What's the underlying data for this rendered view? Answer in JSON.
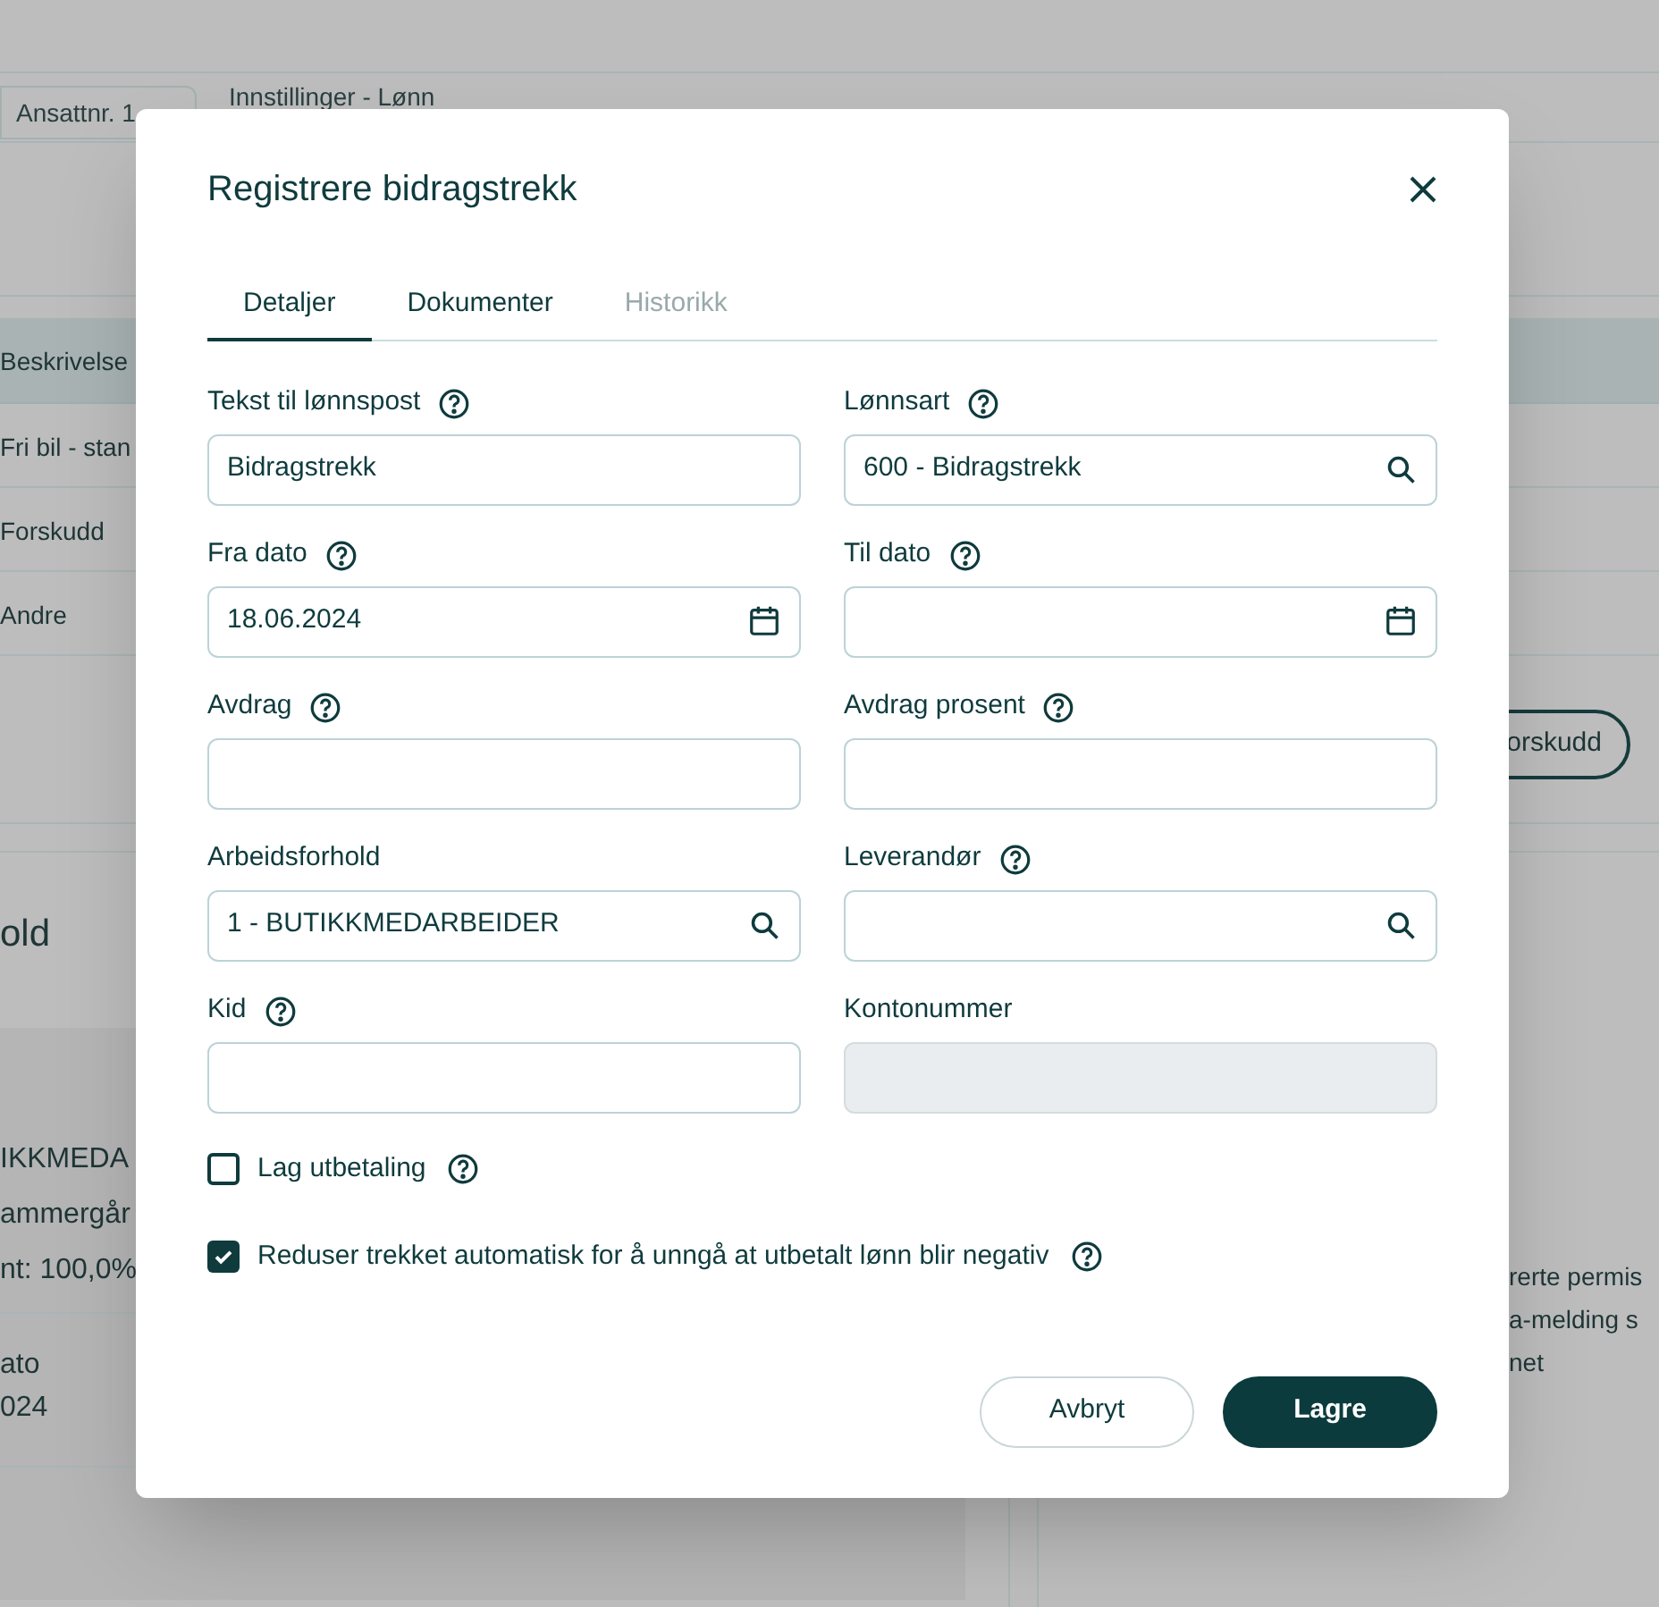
{
  "background": {
    "employee_chip": "Ansattnr. 1",
    "breadcrumb": "Innstillinger - Lønn",
    "table_header": "Beskrivelse",
    "table_rows": [
      "Fri bil - stan",
      "Forskudd",
      "Andre"
    ],
    "section_title": "old",
    "details": [
      "IKKMEDA",
      "ammergår",
      "nt: 100,0%"
    ],
    "date_label": "ato",
    "date_value": "024",
    "side_button": "orskudd",
    "side_lines": [
      "rerte permis",
      "a-melding s",
      "net"
    ]
  },
  "dialog": {
    "title": "Registrere bidragstrekk",
    "tabs": [
      {
        "label": "Detaljer",
        "selected": true,
        "disabled": false
      },
      {
        "label": "Dokumenter",
        "selected": false,
        "disabled": false
      },
      {
        "label": "Historikk",
        "selected": false,
        "disabled": true
      }
    ],
    "fields": [
      {
        "label": "Tekst til lønnspost",
        "help": true,
        "value": "Bidragstrekk",
        "kind": "text",
        "disabled": false
      },
      {
        "label": "Lønnsart",
        "help": true,
        "value": "600 - Bidragstrekk",
        "kind": "lookup",
        "disabled": false
      },
      {
        "label": "Fra dato",
        "help": true,
        "value": "18.06.2024",
        "kind": "date",
        "disabled": false
      },
      {
        "label": "Til dato",
        "help": true,
        "kind": "date",
        "disabled": false
      },
      {
        "label": "Avdrag",
        "help": true,
        "kind": "text",
        "disabled": false
      },
      {
        "label": "Avdrag prosent",
        "help": true,
        "kind": "text",
        "disabled": false
      },
      {
        "label": "Arbeidsforhold",
        "help": false,
        "value": "1 - BUTIKKMEDARBEIDER",
        "kind": "lookup",
        "disabled": false
      },
      {
        "label": "Leverandør",
        "help": true,
        "kind": "lookup",
        "disabled": false
      },
      {
        "label": "Kid",
        "help": true,
        "kind": "text",
        "disabled": false
      },
      {
        "label": "Kontonummer",
        "help": false,
        "kind": "text",
        "disabled": true
      }
    ],
    "checkboxes": [
      {
        "label": "Lag utbetaling",
        "checked": false,
        "help": true
      },
      {
        "label": "Reduser trekket automatisk for å unngå at utbetalt lønn blir negativ",
        "checked": true,
        "help": true
      }
    ],
    "buttons": [
      {
        "label": "Avbryt",
        "kind": "secondary"
      },
      {
        "label": "Lagre",
        "kind": "primary"
      }
    ]
  }
}
